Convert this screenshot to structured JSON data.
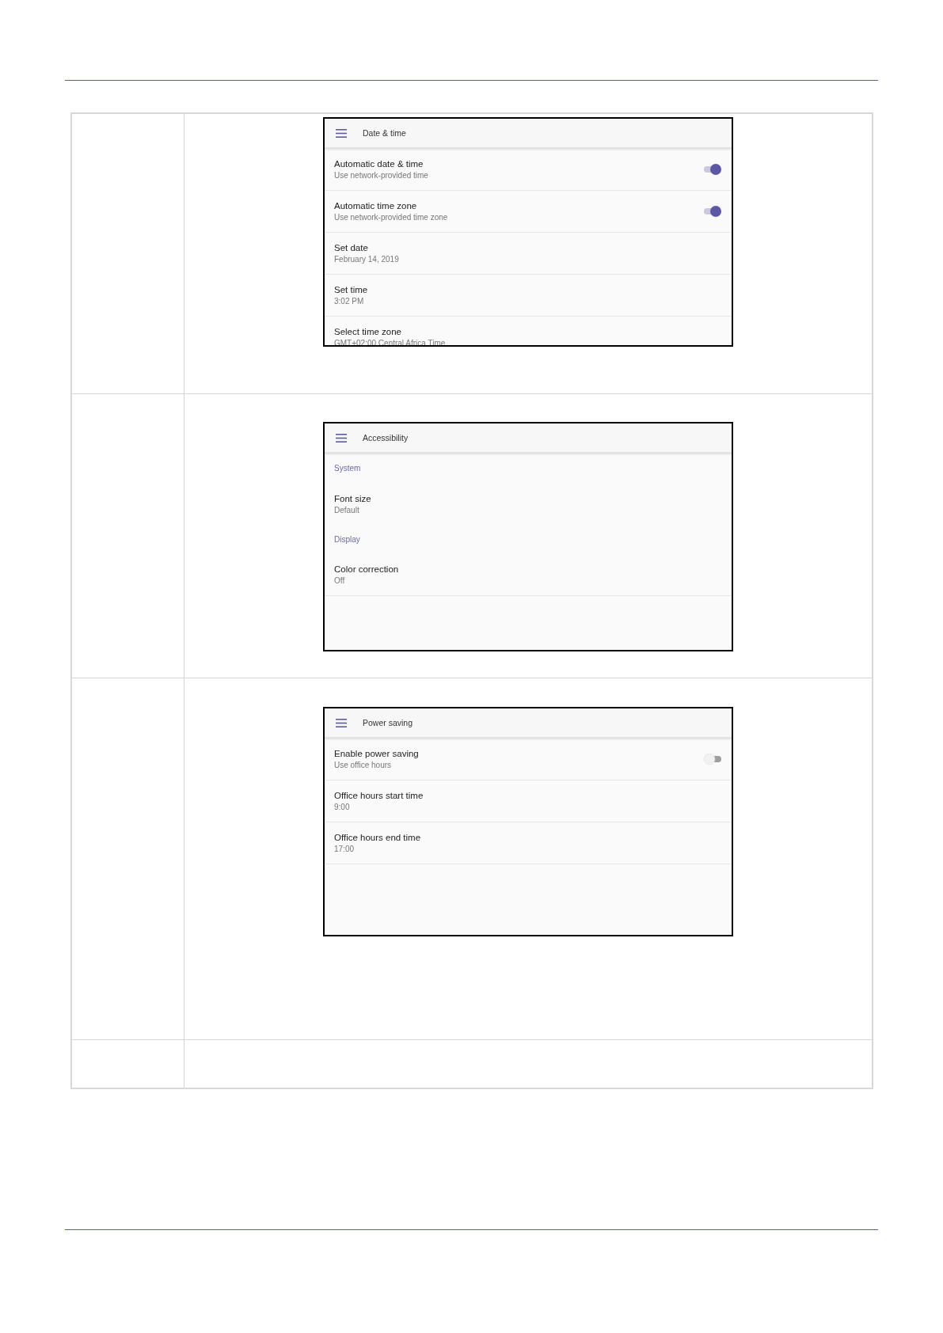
{
  "screens": [
    {
      "title": "Date & time",
      "items": [
        {
          "kind": "toggle",
          "title": "Automatic date & time",
          "subtitle": "Use network-provided time",
          "on": true
        },
        {
          "kind": "toggle",
          "title": "Automatic time zone",
          "subtitle": "Use network-provided time zone",
          "on": true
        },
        {
          "kind": "value",
          "title": "Set date",
          "subtitle": "February 14, 2019"
        },
        {
          "kind": "value",
          "title": "Set time",
          "subtitle": "3:02 PM"
        },
        {
          "kind": "value",
          "title": "Select time zone",
          "subtitle": "GMT+02:00 Central Africa Time"
        }
      ]
    },
    {
      "title": "Accessibility",
      "items": [
        {
          "kind": "section",
          "title": "System"
        },
        {
          "kind": "value",
          "title": "Font size",
          "subtitle": "Default"
        },
        {
          "kind": "section",
          "title": "Display"
        },
        {
          "kind": "value",
          "title": "Color correction",
          "subtitle": "Off"
        }
      ]
    },
    {
      "title": "Power saving",
      "items": [
        {
          "kind": "toggle",
          "title": "Enable power saving",
          "subtitle": "Use office hours",
          "on": false
        },
        {
          "kind": "value",
          "title": "Office hours start time",
          "subtitle": "9:00"
        },
        {
          "kind": "value",
          "title": "Office hours end time",
          "subtitle": "17:00"
        }
      ]
    }
  ]
}
